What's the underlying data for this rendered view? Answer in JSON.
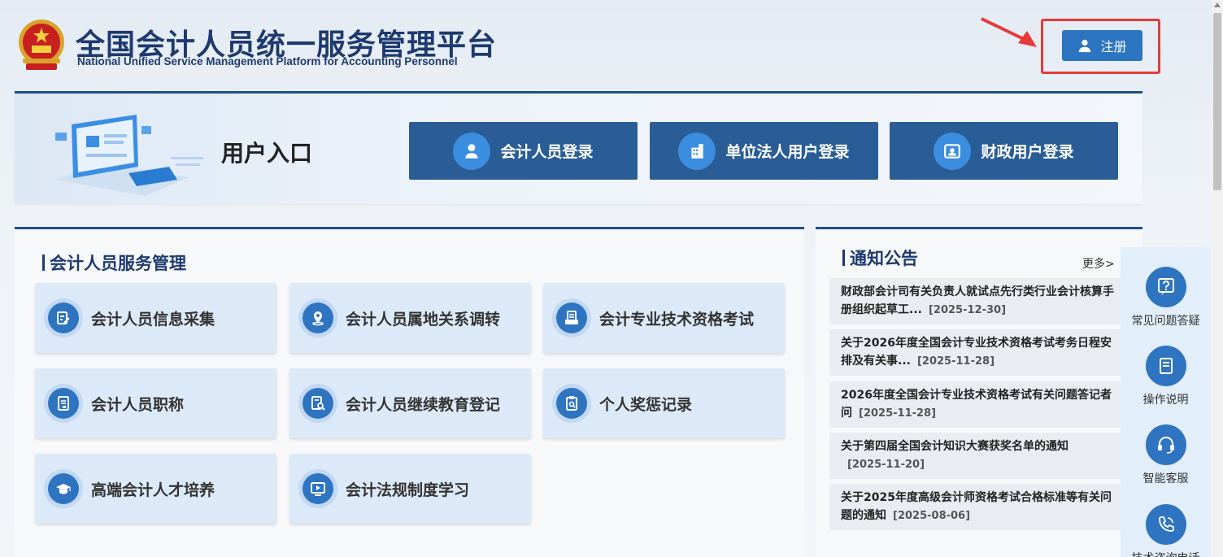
{
  "header": {
    "title": "全国会计人员统一服务管理平台",
    "subtitle": "National Unified Service Management Platform for Accounting Personnel",
    "register_label": "注册"
  },
  "entry": {
    "title": "用户入口",
    "buttons": [
      {
        "label": "会计人员登录",
        "icon": "person-icon"
      },
      {
        "label": "单位法人用户登录",
        "icon": "building-icon"
      },
      {
        "label": "财政用户登录",
        "icon": "id-card-icon"
      }
    ]
  },
  "services": {
    "title": "会计人员服务管理",
    "items": [
      {
        "label": "会计人员信息采集",
        "icon": "edit-doc-icon"
      },
      {
        "label": "会计人员属地关系调转",
        "icon": "location-icon"
      },
      {
        "label": "会计专业技术资格考试",
        "icon": "exam-icon"
      },
      {
        "label": "会计人员职称",
        "icon": "certificate-icon"
      },
      {
        "label": "会计人员继续教育登记",
        "icon": "search-doc-icon"
      },
      {
        "label": "个人奖惩记录",
        "icon": "clipboard-search-icon"
      },
      {
        "label": "高端会计人才培养",
        "icon": "graduation-cap-icon"
      },
      {
        "label": "会计法规制度学习",
        "icon": "play-icon"
      }
    ]
  },
  "notices": {
    "title": "通知公告",
    "more_label": "更多>",
    "items": [
      {
        "text": "财政部会计司有关负责人就试点先行类行业会计核算手册组织起草工...",
        "date": "[2025-12-30]"
      },
      {
        "text": "关于2026年度全国会计专业技术资格考试考务日程安排及有关事...",
        "date": "[2025-11-28]"
      },
      {
        "text": "2026年度全国会计专业技术资格考试有关问题答记者问",
        "date": "[2025-11-28]"
      },
      {
        "text": "关于第四届全国会计知识大赛获奖名单的通知",
        "date": "[2025-11-20]"
      },
      {
        "text": "关于2025年度高级会计师资格考试合格标准等有关问题的通知",
        "date": "[2025-08-06]"
      }
    ]
  },
  "sidebar": {
    "items": [
      {
        "label": "常见问题答疑",
        "icon": "question-icon"
      },
      {
        "label": "操作说明",
        "icon": "book-icon"
      },
      {
        "label": "智能客服",
        "icon": "headset-icon"
      },
      {
        "label": "技术咨询电话",
        "icon": "phone-icon"
      }
    ]
  },
  "colors": {
    "primary_dark": "#2a5d96",
    "primary": "#2f74c1",
    "highlight_red": "#e63a3a",
    "title_navy": "#1e3a6e"
  }
}
